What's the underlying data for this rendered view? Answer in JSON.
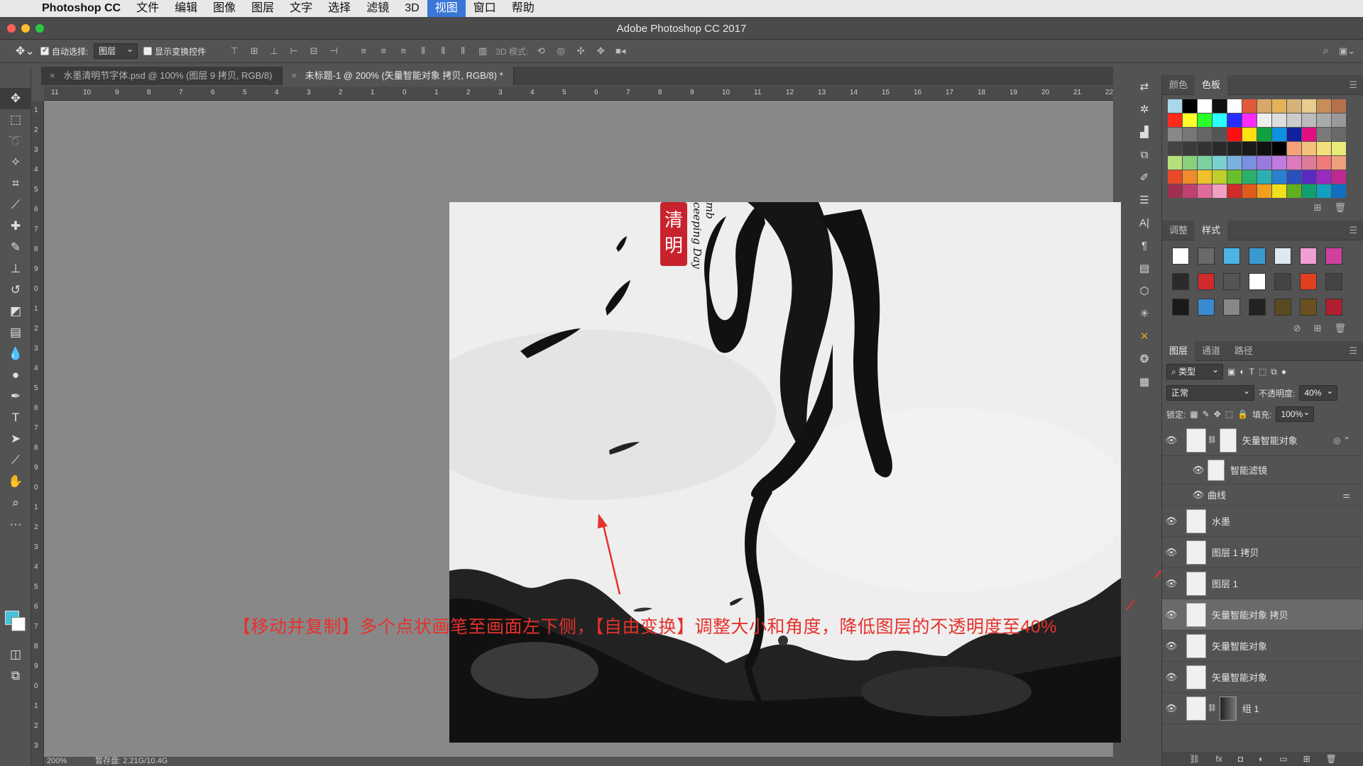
{
  "menubar": {
    "app_name": "Photoshop CC",
    "items": [
      "文件",
      "编辑",
      "图像",
      "图层",
      "文字",
      "选择",
      "滤镜",
      "3D",
      "视图",
      "窗口",
      "帮助"
    ],
    "active_item": "视图"
  },
  "window": {
    "title": "Adobe Photoshop CC 2017"
  },
  "options": {
    "auto_select_label": "自动选择:",
    "auto_select_value": "图层",
    "show_transform_label": "显示变换控件",
    "mode_3d_label": "3D 模式:"
  },
  "doc_tabs": [
    {
      "label": "水墨清明节字体.psd @ 100% (图层 9 拷贝, RGB/8)"
    },
    {
      "label": "未标题-1 @ 200% (矢量智能对象 拷贝, RGB/8) *"
    }
  ],
  "rulers": {
    "h_ticks": [
      "11",
      "10",
      "9",
      "8",
      "7",
      "6",
      "5",
      "4",
      "3",
      "2",
      "1",
      "0",
      "1",
      "2",
      "3",
      "4",
      "5",
      "6",
      "7",
      "8",
      "9",
      "10",
      "11",
      "12",
      "13",
      "14",
      "15",
      "16",
      "17",
      "18",
      "19",
      "20",
      "21",
      "22"
    ],
    "v_ticks": [
      "1",
      "2",
      "3",
      "4",
      "5",
      "6",
      "7",
      "8",
      "9",
      "0",
      "1",
      "2",
      "3",
      "4",
      "5",
      "6",
      "7",
      "8",
      "9",
      "0",
      "1",
      "2",
      "3",
      "4",
      "5",
      "6",
      "7",
      "8",
      "9",
      "0",
      "1",
      "2",
      "3"
    ]
  },
  "canvas": {
    "seal_text": "清明",
    "english_text": "mb\nceeping Day"
  },
  "annotation": "【移动并复制】多个点状画笔至画面左下侧，【自由变换】调整大小和角度，降低图层的不透明度至40%",
  "status": {
    "zoom": "200%",
    "doc_size": "暂存盘: 2.21G/10.4G"
  },
  "panels": {
    "color_tabs": [
      "颜色",
      "色板"
    ],
    "color_active": "色板",
    "adjust_tabs": [
      "调整",
      "样式"
    ],
    "adjust_active": "样式",
    "layers_tabs": [
      "图层",
      "通道",
      "路径"
    ],
    "layers_active": "图层",
    "filter_kind": "类型",
    "blend_mode": "正常",
    "opacity_label": "不透明度:",
    "opacity_value": "40%",
    "lock_label": "锁定:",
    "fill_label": "填充:",
    "fill_value": "100%"
  },
  "layers": [
    {
      "name": "矢量智能对象",
      "type": "smart",
      "has_mask": true
    },
    {
      "name": "智能滤镜",
      "type": "filter-group"
    },
    {
      "name": "曲线",
      "type": "filter"
    },
    {
      "name": "水墨",
      "type": "smart"
    },
    {
      "name": "图层 1 拷贝",
      "type": "normal"
    },
    {
      "name": "图层 1",
      "type": "normal"
    },
    {
      "name": "矢量智能对象 拷贝",
      "type": "smart",
      "selected": true
    },
    {
      "name": "矢量智能对象",
      "type": "smart"
    },
    {
      "name": "矢量智能对象",
      "type": "smart"
    },
    {
      "name": "组 1",
      "type": "group"
    }
  ],
  "swatch_colors": [
    "#a8d8ea",
    "#000000",
    "#ffffff",
    "#111111",
    "#ffffff",
    "#e05a3a",
    "#d7a868",
    "#e3b35a",
    "#d6b27a",
    "#e8cd8e",
    "#c88e5a",
    "#b4714a",
    "#ff2a1a",
    "#ffff2a",
    "#2aff2a",
    "#2affff",
    "#2a2aff",
    "#ff2aff",
    "#eeeeee",
    "#dddddd",
    "#cccccc",
    "#bbbbbb",
    "#aaaaaa",
    "#999999",
    "#888888",
    "#777777",
    "#666666",
    "#555555",
    "#ff1010",
    "#ffe010",
    "#10a040",
    "#1090e0",
    "#1020a0",
    "#e01080",
    "#7a7a7a",
    "#6a6a6a",
    "#444444",
    "#3a3a3a",
    "#333333",
    "#2a2a2a",
    "#222222",
    "#1a1a1a",
    "#111111",
    "#000000",
    "#f4a27a",
    "#f4c07a",
    "#f4de7a",
    "#e8ea7a",
    "#b8e07a",
    "#8ad07a",
    "#7ad0a0",
    "#7ad0d0",
    "#7ab0e0",
    "#7a90e0",
    "#9a7ae0",
    "#c07ae0",
    "#e07ac0",
    "#e07a9a",
    "#f07a7a",
    "#f0a07a",
    "#e84a2a",
    "#f08a2a",
    "#f0c02a",
    "#c0d02a",
    "#6ac02a",
    "#2ab06a",
    "#2ab0b0",
    "#2a80d0",
    "#2a50c0",
    "#5a2ac0",
    "#9a2ac0",
    "#c02a90",
    "#a03050",
    "#c04070",
    "#e06a9a",
    "#f0a0c0",
    "#d02a2a",
    "#e05a1a",
    "#f0a01a",
    "#f0e01a",
    "#60b020",
    "#10a070",
    "#10a0c0",
    "#1070c0"
  ],
  "style_swatches": [
    "#ffffff",
    "#6a6a6a",
    "#4ab4e4",
    "#3a9ad0",
    "#dfe8f0",
    "#f0a0d0",
    "#d040a0",
    "#2a2a2a",
    "#d02a2a",
    "#555555",
    "#ffffff",
    "#444444",
    "#e04020",
    "#444444",
    "#1a1a1a",
    "#3a8ad0",
    "#888888",
    "#222222",
    "#5a4a20",
    "#6a5020",
    "#b02030"
  ]
}
